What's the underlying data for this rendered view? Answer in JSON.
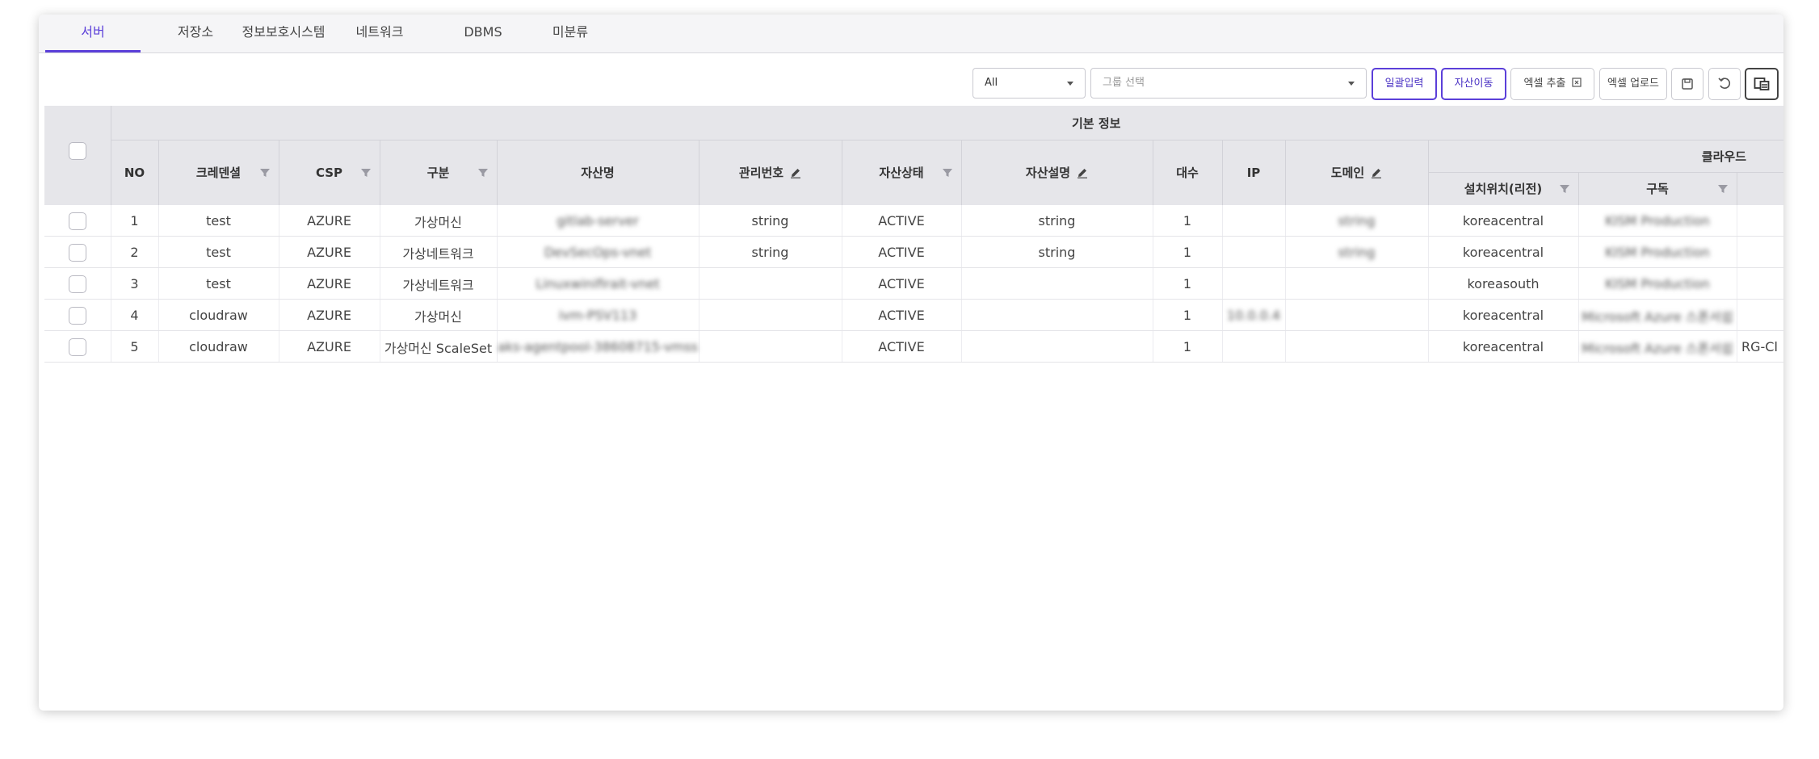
{
  "tabs": [
    {
      "label": "서버",
      "active": true
    },
    {
      "label": "저장소"
    },
    {
      "label": "정보보호시스템"
    },
    {
      "label": "네트워크"
    },
    {
      "label": "DBMS"
    },
    {
      "label": "미분류"
    }
  ],
  "toolbar": {
    "scope_select_value": "All",
    "group_select_placeholder": "그룹 선택",
    "bulk_input_label": "일괄입력",
    "asset_move_label": "자산이동",
    "excel_export_label": "엑셀 추출",
    "excel_upload_label": "엑셀 업로드"
  },
  "table": {
    "group_headers": {
      "basic_info": "기본 정보",
      "cloud": "클라우드"
    },
    "columns": {
      "no": "NO",
      "credential": "크레덴셜",
      "csp": "CSP",
      "type": "구분",
      "asset_name": "자산명",
      "manage_no": "관리번호",
      "asset_status": "자산상태",
      "asset_desc": "자산설명",
      "count": "대수",
      "ip": "IP",
      "domain": "도메인",
      "region": "설치위치(리전)",
      "subscription": "구독"
    },
    "rows": [
      {
        "no": "1",
        "credential": "test",
        "csp": "AZURE",
        "type": "가상머신",
        "asset_name": "gitlab-server",
        "manage_no": "string",
        "status": "ACTIVE",
        "desc": "string",
        "count": "1",
        "ip": "",
        "domain": "string",
        "region": "koreacentral",
        "subscription": "KISM Production",
        "extra": ""
      },
      {
        "no": "2",
        "credential": "test",
        "csp": "AZURE",
        "type": "가상네트워크",
        "asset_name": "DevSecOps-vnet",
        "manage_no": "string",
        "status": "ACTIVE",
        "desc": "string",
        "count": "1",
        "ip": "",
        "domain": "string",
        "region": "koreacentral",
        "subscription": "KISM Production",
        "extra": ""
      },
      {
        "no": "3",
        "credential": "test",
        "csp": "AZURE",
        "type": "가상네트워크",
        "asset_name": "Linuxwinifirait-vnet",
        "manage_no": "",
        "status": "ACTIVE",
        "desc": "",
        "count": "1",
        "ip": "",
        "domain": "",
        "region": "koreasouth",
        "subscription": "KISM Production",
        "extra": ""
      },
      {
        "no": "4",
        "credential": "cloudraw",
        "csp": "AZURE",
        "type": "가상머신",
        "asset_name": "ivm-PSV113",
        "manage_no": "",
        "status": "ACTIVE",
        "desc": "",
        "count": "1",
        "ip": "10.0.0.4",
        "domain": "",
        "region": "koreacentral",
        "subscription": "Microsoft Azure 스폰서쉽",
        "extra": ""
      },
      {
        "no": "5",
        "credential": "cloudraw",
        "csp": "AZURE",
        "type": "가상머신 ScaleSet",
        "asset_name": "aks-agentpool-38608715-vmss",
        "manage_no": "",
        "status": "ACTIVE",
        "desc": "",
        "count": "1",
        "ip": "",
        "domain": "",
        "region": "koreacentral",
        "subscription": "Microsoft Azure 스폰서쉽",
        "extra": "RG-Cl"
      }
    ]
  },
  "colors": {
    "accent": "#5b3fd9",
    "header_bg": "#e6e6ea"
  }
}
